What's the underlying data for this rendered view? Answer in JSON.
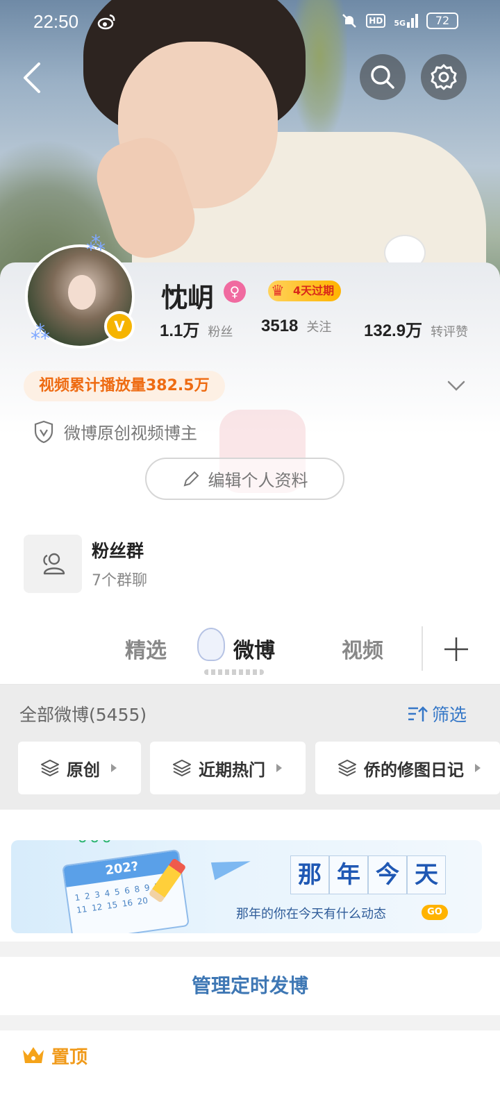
{
  "status_bar": {
    "time": "22:50",
    "network": "5G",
    "hd": "HD",
    "battery": "72"
  },
  "profile": {
    "name": "忱岄",
    "vip_badge": "4天过期",
    "stats": [
      {
        "value": "1.1万",
        "label": "粉丝"
      },
      {
        "value": "3518",
        "label": "关注"
      },
      {
        "value": "132.9万",
        "label": "转评赞"
      }
    ],
    "play_count": "视频累计播放量382.5万",
    "certification": "微博原创视频博主",
    "edit_button": "编辑个人资料"
  },
  "fan_group": {
    "title": "粉丝群",
    "subtitle": "7个群聊"
  },
  "tabs": [
    {
      "label": "精选",
      "active": false
    },
    {
      "label": "微博",
      "active": true
    },
    {
      "label": "视频",
      "active": false
    }
  ],
  "feed": {
    "count_label": "全部微博(5455)",
    "filter_label": "筛选",
    "chips": [
      "原创",
      "近期热门",
      "侨的修图日记"
    ]
  },
  "memory_banner": {
    "year": "202?",
    "calendar_numbers": "1 2 3 4 5 6 8 9 10 11 12 15 16 20",
    "chars": [
      "那",
      "年",
      "今",
      "天"
    ],
    "subtitle": "那年的你在今天有什么动态",
    "go": "GO"
  },
  "manage_scheduled": "管理定时发博",
  "pinned_label": "置顶",
  "colors": {
    "accent_blue": "#3577c7",
    "orange": "#ee6b12",
    "vip_gold": "#ffb400",
    "pinned_orange": "#f09a1a"
  }
}
